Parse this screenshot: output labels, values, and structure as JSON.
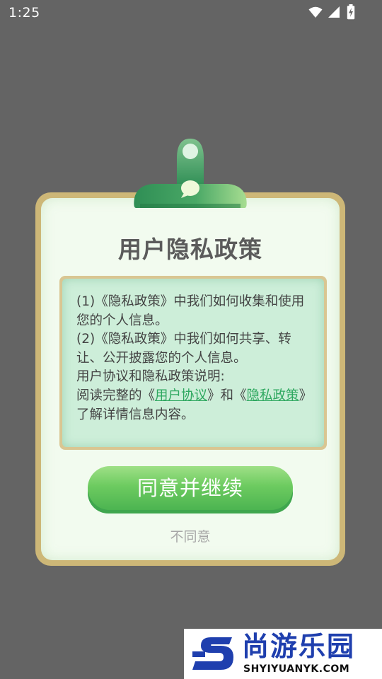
{
  "status_bar": {
    "time": "1:25",
    "icons": [
      "wifi-icon",
      "signal-icon",
      "battery-charging-icon"
    ]
  },
  "dialog": {
    "title": "用户隐私政策",
    "paragraphs": [
      {
        "before": "(1)《隐私政策》中我们如何收集和使用您的个人信息。"
      },
      {
        "before": "(2)《隐私政策》中我们如何共享、转让、公开披露您的个人信息。"
      },
      {
        "before": "用户协议和隐私政策说明:"
      },
      {
        "before": "阅读完整的《",
        "link1": "用户协议",
        "middle": "》和《",
        "link2": "隐私政策",
        "after": "》了解详情信息内容。"
      }
    ],
    "agree_label": "同意并继续",
    "decline_label": "不同意"
  },
  "watermark": {
    "name": "尚游乐园",
    "url": "SHYIYUANYK.COM",
    "logo_letter": "S"
  },
  "colors": {
    "background": "#646464",
    "frame_gold": "#cdb777",
    "card": "#f2fbef",
    "content_bg": "#cdeed9",
    "link": "#2fa860",
    "button_green": "#6dcb60",
    "watermark_blue": "#1f3fae"
  }
}
